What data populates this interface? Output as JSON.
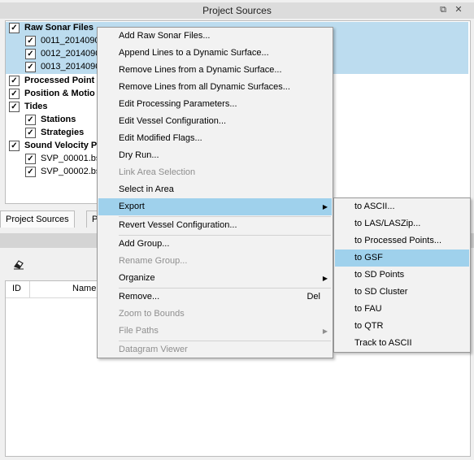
{
  "window": {
    "title": "Project Sources"
  },
  "tree": {
    "items": [
      {
        "label": "Raw Sonar Files",
        "bold": true,
        "checked": true,
        "selected": true
      },
      {
        "label": "0011_2014090",
        "checked": true,
        "selected": true
      },
      {
        "label": "0012_2014090",
        "checked": true,
        "selected": true
      },
      {
        "label": "0013_2014090",
        "checked": true,
        "selected": true
      },
      {
        "label": "Processed Point F",
        "bold": true,
        "checked": true
      },
      {
        "label": "Position & Motio",
        "bold": true,
        "checked": true
      },
      {
        "label": "Tides",
        "bold": true,
        "checked": true
      },
      {
        "label": "Stations",
        "bold": true,
        "checked": true
      },
      {
        "label": "Strategies",
        "bold": true,
        "checked": true
      },
      {
        "label": "Sound Velocity Pr",
        "bold": true,
        "checked": true
      },
      {
        "label": "SVP_00001.bs",
        "checked": true
      },
      {
        "label": "SVP_00002.bs",
        "checked": true
      }
    ]
  },
  "tabs": [
    "Project Sources",
    "P"
  ],
  "table": {
    "columns": [
      "ID",
      "Name"
    ]
  },
  "context_menu": {
    "items": [
      {
        "label": "Add Raw Sonar Files..."
      },
      {
        "label": "Append Lines to a Dynamic Surface..."
      },
      {
        "label": "Remove Lines from a Dynamic Surface..."
      },
      {
        "label": "Remove Lines from all Dynamic Surfaces..."
      },
      {
        "label": "Edit Processing Parameters..."
      },
      {
        "label": "Edit Vessel Configuration..."
      },
      {
        "label": "Edit Modified Flags..."
      },
      {
        "label": "Dry Run..."
      },
      {
        "label": "Link Area Selection",
        "disabled": true
      },
      {
        "label": "Select in Area"
      },
      {
        "label": "Export",
        "submenu": true,
        "highlighted": true
      },
      {
        "label": "Revert Vessel Configuration..."
      },
      {
        "label": "Add Group..."
      },
      {
        "label": "Rename Group...",
        "disabled": true
      },
      {
        "label": "Organize",
        "submenu": true
      },
      {
        "label": "Remove...",
        "shortcut": "Del"
      },
      {
        "label": "Zoom to Bounds",
        "disabled": true
      },
      {
        "label": "File Paths",
        "submenu": true,
        "disabled": true
      },
      {
        "label": "Datagram Viewer",
        "disabled": true
      }
    ]
  },
  "export_submenu": {
    "items": [
      {
        "label": "to ASCII..."
      },
      {
        "label": "to LAS/LASZip..."
      },
      {
        "label": "to Processed Points..."
      },
      {
        "label": "to GSF",
        "highlighted": true
      },
      {
        "label": "to SD Points"
      },
      {
        "label": "to SD Cluster"
      },
      {
        "label": "to FAU"
      },
      {
        "label": "to QTR"
      },
      {
        "label": "Track to ASCII"
      }
    ]
  },
  "colors": {
    "selection": "#bcdcef",
    "menu_highlight": "#9fd1ec"
  }
}
